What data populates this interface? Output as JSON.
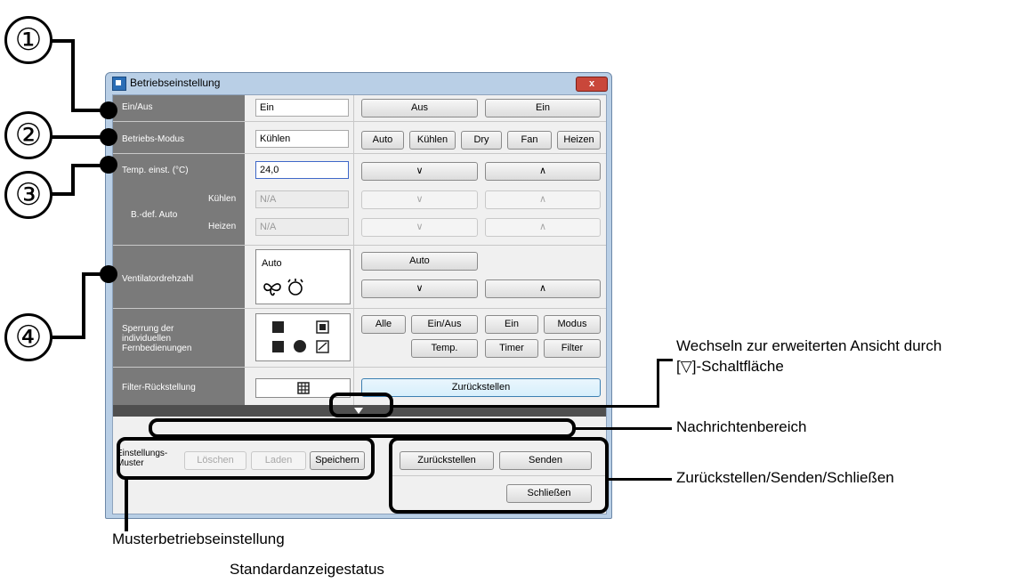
{
  "window": {
    "title": "Betriebseinstellung",
    "close": "x"
  },
  "onoff": {
    "label": "Ein/Aus",
    "value": "Ein",
    "buttons": [
      "Aus",
      "Ein"
    ]
  },
  "mode": {
    "label": "Betriebs-Modus",
    "value": "Kühlen",
    "buttons": [
      "Auto",
      "Kühlen",
      "Dry",
      "Fan",
      "Heizen"
    ]
  },
  "temp": {
    "label": "Temp. einst. (°C)",
    "value": "24,0",
    "down": "∨",
    "up": "∧",
    "auto_label": "B.-def. Auto",
    "cool_label": "Kühlen",
    "heat_label": "Heizen",
    "cool_value": "N/A",
    "heat_value": "N/A"
  },
  "fan": {
    "label": "Ventilatordrehzahl",
    "value": "Auto",
    "auto_button": "Auto",
    "down": "∨",
    "up": "∧"
  },
  "lock": {
    "label_1": "Sperrung der",
    "label_2": "individuellen",
    "label_3": "Fernbedienungen",
    "buttons_row1": [
      "Alle",
      "Ein/Aus",
      "Ein",
      "Modus"
    ],
    "buttons_row2": [
      "Temp.",
      "Timer",
      "Filter"
    ]
  },
  "filter": {
    "label": "Filter-Rückstellung",
    "reset": "Zurückstellen"
  },
  "pattern": {
    "label_1": "Einstellungs-",
    "label_2": "Muster",
    "delete": "Löschen",
    "load": "Laden",
    "save": "Speichern"
  },
  "actions": {
    "reset": "Zurückstellen",
    "send": "Senden",
    "close": "Schließen"
  },
  "annotations": {
    "n1": "①",
    "n2": "②",
    "n3": "③",
    "n4": "④",
    "expand_1": "Wechseln zur erweiterten Ansicht durch",
    "expand_2": "[▽]-Schaltfläche",
    "message": "Nachrichtenbereich",
    "reset_send_close": "Zurückstellen/Senden/Schließen",
    "pattern": "Musterbetriebseinstellung",
    "caption": "Standardanzeigestatus"
  }
}
